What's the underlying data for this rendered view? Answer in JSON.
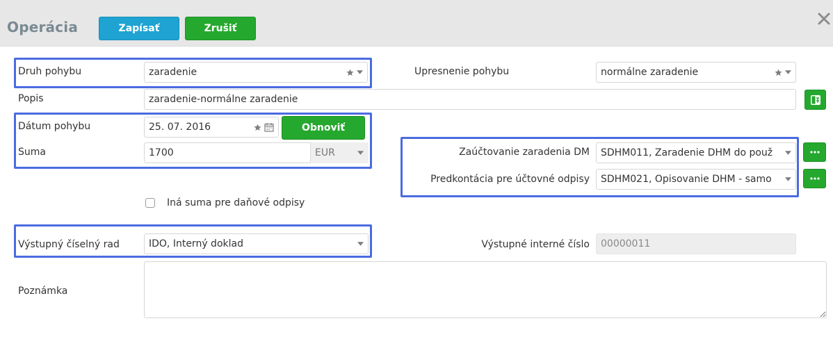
{
  "header": {
    "title": "Operácia",
    "save_label": "Zapísať",
    "cancel_label": "Zrušiť",
    "close_icon": "close-icon"
  },
  "form": {
    "druh_pohybu": {
      "label": "Druh pohybu",
      "value": "zaradenie"
    },
    "upresnenie_pohybu": {
      "label": "Upresnenie pohybu",
      "value": "normálne zaradenie"
    },
    "popis": {
      "label": "Popis",
      "value": "zaradenie-normálne zaradenie"
    },
    "datum_pohybu": {
      "label": "Dátum pohybu",
      "value": "25. 07. 2016"
    },
    "obnovit_label": "Obnoviť",
    "suma": {
      "label": "Suma",
      "value": "1700",
      "currency": "EUR"
    },
    "zauctovanie": {
      "label": "Zaúčtovanie zaradenia DM",
      "value": "SDHM011, Zaradenie DHM do použ"
    },
    "predkontacia": {
      "label": "Predkontácia pre účtovné odpisy",
      "value": "SDHM021, Opisovanie DHM - samo"
    },
    "ina_suma": {
      "label": "Iná suma pre daňové odpisy",
      "checked": false
    },
    "vystupny_rad": {
      "label": "Výstupný číselný rad",
      "value": "IDO, Interný doklad"
    },
    "vystupne_cislo": {
      "label": "Výstupné interné číslo",
      "value": "00000011"
    },
    "poznamka": {
      "label": "Poznámka",
      "value": ""
    }
  },
  "colors": {
    "save": "#1ea3d2",
    "green": "#25a82e",
    "highlight": "#4a6be0",
    "header_bg": "#e7e7e7"
  }
}
